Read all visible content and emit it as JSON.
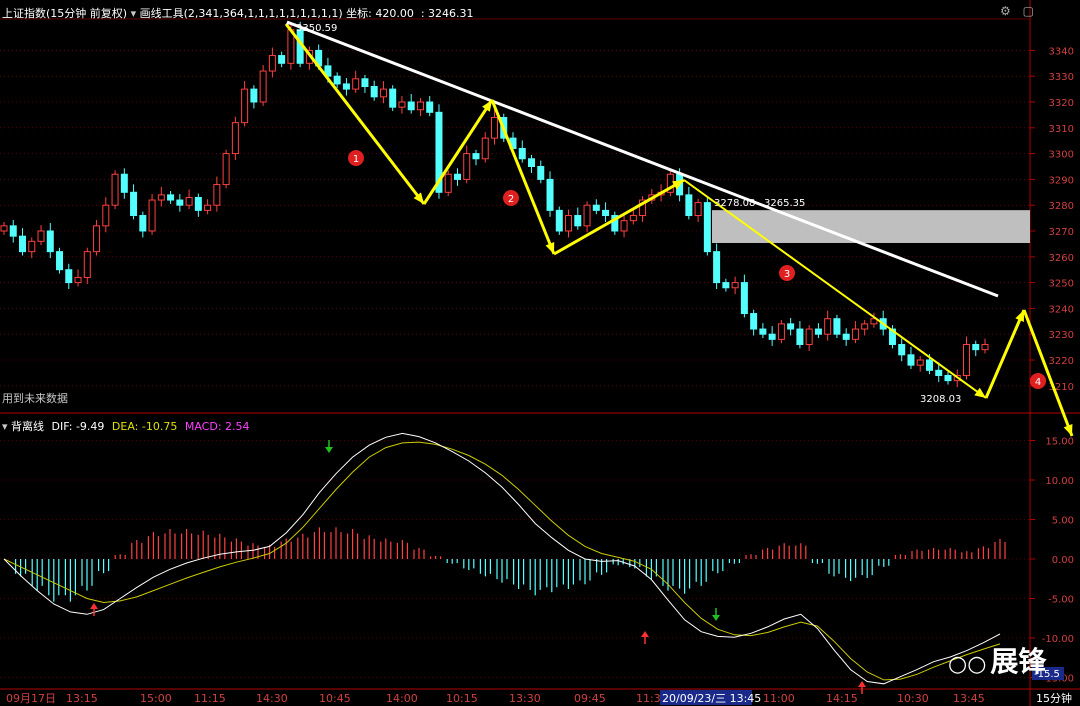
{
  "header": {
    "title": "上证指数(15分钟 前复权)",
    "tool_label": "画线工具",
    "tool_params": "(2,341,364,1,1,1,1,1,1,1,1,1)",
    "coord_label": "坐标:",
    "coord_value": "420.00",
    "price_value": ": 3246.31"
  },
  "overlay_text": {
    "future_data": "用到未来数据",
    "watermark": "展锋",
    "high_label": "3350.59",
    "low_label": "3208.03",
    "zone_top_label": "3278.08",
    "zone_bottom_label": "3265.35",
    "markers": [
      "1",
      "2",
      "3",
      "4"
    ],
    "current_macd_tag": "-15.5"
  },
  "macd_header": {
    "name": "背离线",
    "dif_label": "DIF:",
    "dif_value": "-9.49",
    "dea_label": "DEA:",
    "dea_value": "-10.75",
    "macd_label": "MACD:",
    "macd_value": "2.54"
  },
  "colors": {
    "up": "#ff4040",
    "down": "#54ffff",
    "trend_line": "#ffffff",
    "zigzag": "#ffff00",
    "dea": "#cccc00",
    "dif": "#ffffff",
    "macd_text": "#ff00ff",
    "grid": "#8b0000",
    "zone": "#bfbfbf"
  },
  "chart_data": [
    {
      "type": "candlestick",
      "title": "上证指数(15分钟 前复权)",
      "ylim": [
        3200,
        3350
      ],
      "y_ticks": [
        3210,
        3220,
        3230,
        3240,
        3250,
        3260,
        3270,
        3280,
        3290,
        3300,
        3310,
        3320,
        3330,
        3340
      ],
      "x_ticks": [
        "09月17日",
        "13:15",
        "15:00",
        "11:15",
        "14:30",
        "10:45",
        "14:00",
        "10:15",
        "13:30",
        "09:45",
        "11:30",
        "20/09/23/三 13:45",
        "11:00",
        "14:15",
        "10:30",
        "13:45"
      ],
      "period_label": "15分钟",
      "high": 3350.59,
      "low": 3208.03,
      "resistance_zone": [
        3265.35,
        3278.08
      ],
      "close": [
        3272,
        3268,
        3262,
        3266,
        3270,
        3262,
        3255,
        3250,
        3252,
        3262,
        3272,
        3280,
        3292,
        3285,
        3276,
        3270,
        3282,
        3284,
        3282,
        3280,
        3283,
        3278,
        3280,
        3288,
        3300,
        3312,
        3325,
        3320,
        3332,
        3338,
        3335,
        3348,
        3335,
        3340,
        3334,
        3330,
        3327,
        3325,
        3329,
        3326,
        3322,
        3325,
        3318,
        3320,
        3317,
        3320,
        3316,
        3285,
        3292,
        3290,
        3300,
        3298,
        3306,
        3314,
        3306,
        3302,
        3298,
        3295,
        3290,
        3278,
        3270,
        3276,
        3272,
        3280,
        3278,
        3276,
        3270,
        3274,
        3276,
        3282,
        3284,
        3285,
        3292,
        3284,
        3276,
        3281,
        3262,
        3250,
        3248,
        3250,
        3238,
        3232,
        3230,
        3228,
        3234,
        3232,
        3226,
        3232,
        3230,
        3236,
        3230,
        3228,
        3232,
        3234,
        3236,
        3232,
        3226,
        3222,
        3218,
        3220,
        3216,
        3214,
        3212,
        3214,
        3226,
        3224,
        3226
      ]
    },
    {
      "type": "bar+line",
      "title": "背离线",
      "ylim": [
        -17,
        17
      ],
      "y_ticks": [
        15.0,
        10.0,
        5.0,
        0.0,
        -5.0,
        -10.0,
        -15.0
      ],
      "series": [
        {
          "name": "DIF",
          "values": [
            0.0,
            -2.1,
            -4.0,
            -5.7,
            -6.7,
            -7.0,
            -6.4,
            -5.0,
            -3.6,
            -2.3,
            -1.3,
            -0.5,
            0.1,
            0.6,
            0.9,
            1.1,
            1.6,
            3.3,
            5.6,
            8.4,
            10.8,
            12.9,
            14.4,
            15.4,
            15.9,
            15.5,
            14.7,
            13.6,
            12.4,
            10.9,
            9.1,
            6.9,
            4.5,
            2.7,
            1.1,
            0.0,
            -0.3,
            -0.2,
            -0.9,
            -2.6,
            -5.2,
            -7.7,
            -9.2,
            -9.8,
            -9.9,
            -9.4,
            -8.6,
            -7.6,
            -7.0,
            -8.8,
            -11.5,
            -14.0,
            -15.5,
            -15.8,
            -14.9,
            -14.0,
            -13.0,
            -12.4,
            -11.6,
            -10.6,
            -9.5
          ]
        },
        {
          "name": "DEA",
          "values": [
            0.0,
            -1.0,
            -2.0,
            -3.0,
            -4.0,
            -5.0,
            -5.5,
            -5.3,
            -4.8,
            -4.0,
            -3.2,
            -2.4,
            -1.7,
            -1.0,
            -0.4,
            0.1,
            0.7,
            2.0,
            4.0,
            6.4,
            8.8,
            11.0,
            12.9,
            14.1,
            14.7,
            14.8,
            14.5,
            13.9,
            13.1,
            12.0,
            10.6,
            8.8,
            6.8,
            4.8,
            3.0,
            1.6,
            0.7,
            0.2,
            -0.3,
            -1.3,
            -3.2,
            -5.5,
            -7.5,
            -8.9,
            -9.6,
            -9.7,
            -9.3,
            -8.6,
            -8.0,
            -8.5,
            -10.4,
            -12.6,
            -14.3,
            -15.3,
            -15.2,
            -14.6,
            -13.7,
            -12.9,
            -12.1,
            -11.4,
            -10.75
          ]
        },
        {
          "name": "MACD",
          "values": [
            0.0,
            -2.2,
            -4.0,
            -5.4,
            -5.4,
            -4.0,
            -1.8,
            0.6,
            2.4,
            3.4,
            3.8,
            3.8,
            3.6,
            3.2,
            2.6,
            2.0,
            1.8,
            2.6,
            3.2,
            4.0,
            4.0,
            3.8,
            3.0,
            2.6,
            2.4,
            1.4,
            0.4,
            -0.6,
            -1.4,
            -2.2,
            -3.0,
            -3.8,
            -4.6,
            -4.2,
            -3.8,
            -3.2,
            -2.0,
            -0.8,
            -1.2,
            -2.6,
            -4.0,
            -4.4,
            -3.4,
            -1.8,
            -0.6,
            0.6,
            1.4,
            2.0,
            2.0,
            -0.6,
            -2.2,
            -2.8,
            -2.4,
            -1.0,
            0.6,
            1.2,
            1.4,
            1.4,
            1.0,
            1.6,
            2.54
          ]
        }
      ]
    }
  ]
}
